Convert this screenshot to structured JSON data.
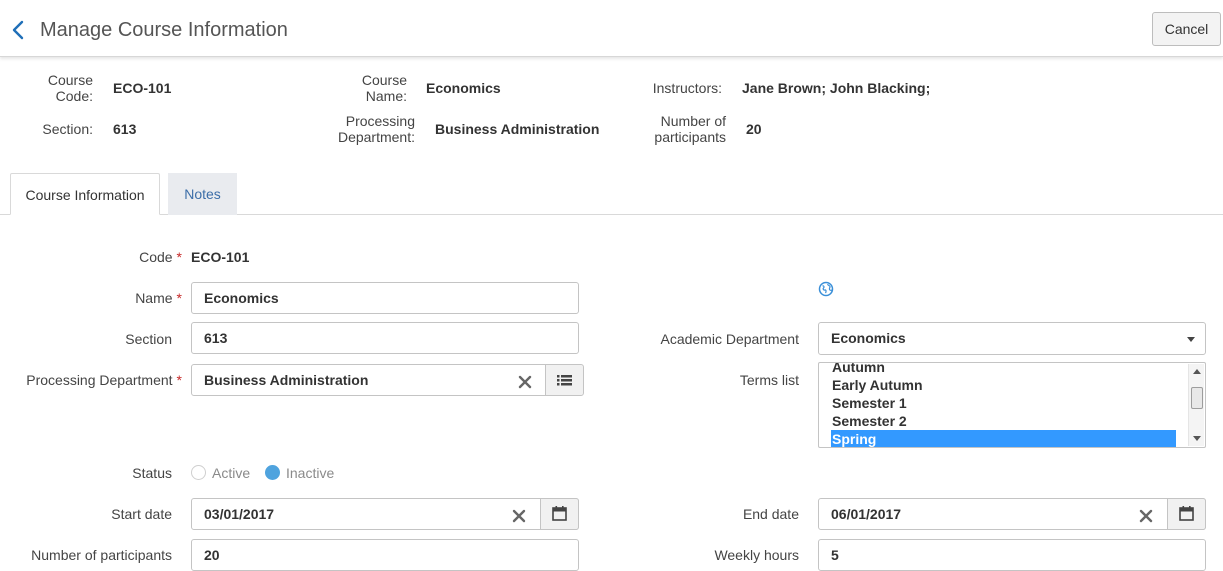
{
  "header": {
    "title": "Manage Course Information",
    "cancel_label": "Cancel",
    "back_icon": "chevron-left-icon",
    "accent_color": "#1f6fb8"
  },
  "summary": {
    "course_code": {
      "label_line1": "Course",
      "label_line2": "Code:",
      "value": "ECO-101"
    },
    "course_name": {
      "label_line1": "Course",
      "label_line2": "Name:",
      "value": "Economics"
    },
    "instructors": {
      "label": "Instructors:",
      "value": "Jane Brown; John Blacking;"
    },
    "section": {
      "label": "Section:",
      "value": "613"
    },
    "processing_department": {
      "label_line1": "Processing",
      "label_line2": "Department:",
      "value": "Business Administration"
    },
    "participants": {
      "label_line1": "Number of",
      "label_line2": "participants",
      "value": "20"
    }
  },
  "tabs": [
    {
      "label": "Course Information",
      "active": true
    },
    {
      "label": "Notes",
      "active": false
    }
  ],
  "form": {
    "code": {
      "label": "Code",
      "required_mark": "*",
      "value": "ECO-101"
    },
    "name": {
      "label": "Name",
      "required_mark": "*",
      "value": "Economics"
    },
    "section": {
      "label": "Section",
      "value": "613"
    },
    "processing_department": {
      "label": "Processing Department",
      "required_mark": "*",
      "value": "Business Administration"
    },
    "academic_department": {
      "label": "Academic Department",
      "value": "Economics"
    },
    "terms_list": {
      "label": "Terms list",
      "options": [
        "Autumn",
        "Early Autumn",
        "Semester 1",
        "Semester 2",
        "Spring"
      ],
      "selected": "Spring"
    },
    "status": {
      "label": "Status",
      "options": [
        "Active",
        "Inactive"
      ],
      "selected": "Inactive"
    },
    "start_date": {
      "label": "Start date",
      "value": "03/01/2017"
    },
    "end_date": {
      "label": "End date",
      "value": "06/01/2017"
    },
    "participants": {
      "label": "Number of participants",
      "value": "20"
    },
    "weekly_hours": {
      "label": "Weekly hours",
      "value": "5"
    }
  },
  "colors": {
    "selection": "#3399ff",
    "radio_selected": "#4fa3de",
    "required": "#c62828",
    "notes_tab_text": "#3c6ea8"
  }
}
